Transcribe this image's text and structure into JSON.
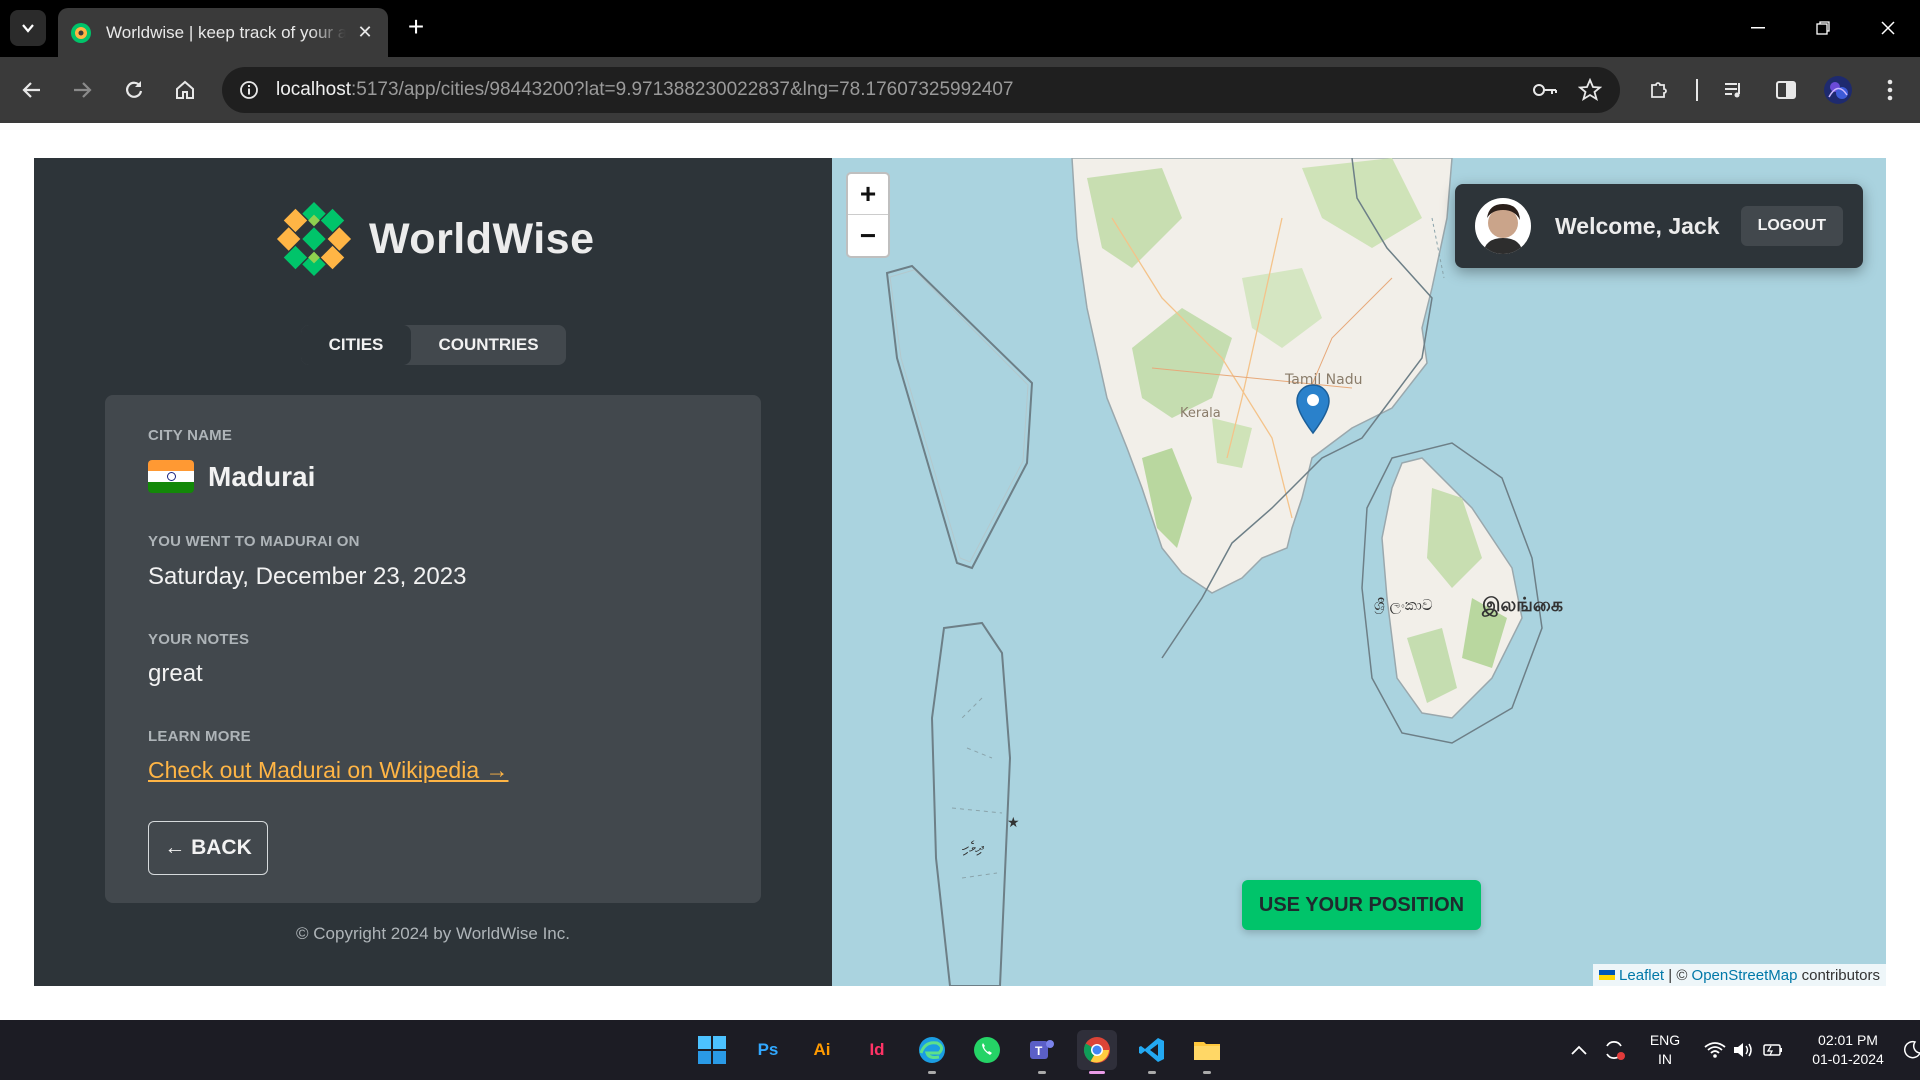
{
  "browser": {
    "tab_title": "Worldwise | keep track of your adventures",
    "url_host": "localhost",
    "url_rest": ":5173/app/cities/98443200?lat=9.971388230022837&lng=78.17607325992407"
  },
  "app": {
    "logo_text": "WorldWise",
    "tabs": {
      "cities": "CITIES",
      "countries": "COUNTRIES"
    },
    "city": {
      "name_label": "CITY NAME",
      "name": "Madurai",
      "date_label": "YOU WENT TO MADURAI ON",
      "date": "Saturday, December 23, 2023",
      "notes_label": "YOUR NOTES",
      "notes": "great",
      "learn_label": "LEARN MORE",
      "wiki_link": "Check out Madurai on Wikipedia →",
      "back": "← BACK"
    },
    "copyright": "© Copyright 2024 by WorldWise Inc.",
    "colors": {
      "sidebar_bg": "#2d3439",
      "card_bg": "#42484d",
      "brand_green": "#00c46a",
      "link_orange": "#ffb545"
    }
  },
  "map": {
    "zoom_in": "+",
    "zoom_out": "−",
    "welcome": "Welcome, Jack",
    "logout": "LOGOUT",
    "use_position": "USE YOUR POSITION",
    "attribution": {
      "leaflet": "Leaflet",
      "sep": " | © ",
      "osm": "OpenStreetMap",
      "tail": " contributors"
    },
    "labels": {
      "tamil_nadu": "Tamil Nadu",
      "kerala": "Kerala",
      "sri_lanka_si": "ශ්‍රී ලංකාව",
      "sri_lanka_ta": "இலங்கை",
      "maldives": "ދިވެހި"
    }
  },
  "taskbar": {
    "apps": [
      {
        "name": "windows-start",
        "label": ""
      },
      {
        "name": "photoshop",
        "label": "Ps"
      },
      {
        "name": "illustrator",
        "label": "Ai"
      },
      {
        "name": "indesign",
        "label": "Id"
      },
      {
        "name": "edge",
        "label": ""
      },
      {
        "name": "whatsapp",
        "label": ""
      },
      {
        "name": "teams",
        "label": ""
      },
      {
        "name": "chrome",
        "label": ""
      },
      {
        "name": "vscode",
        "label": ""
      },
      {
        "name": "file-explorer",
        "label": ""
      }
    ],
    "lang_top": "ENG",
    "lang_bottom": "IN",
    "time": "02:01 PM",
    "date": "01-01-2024"
  }
}
